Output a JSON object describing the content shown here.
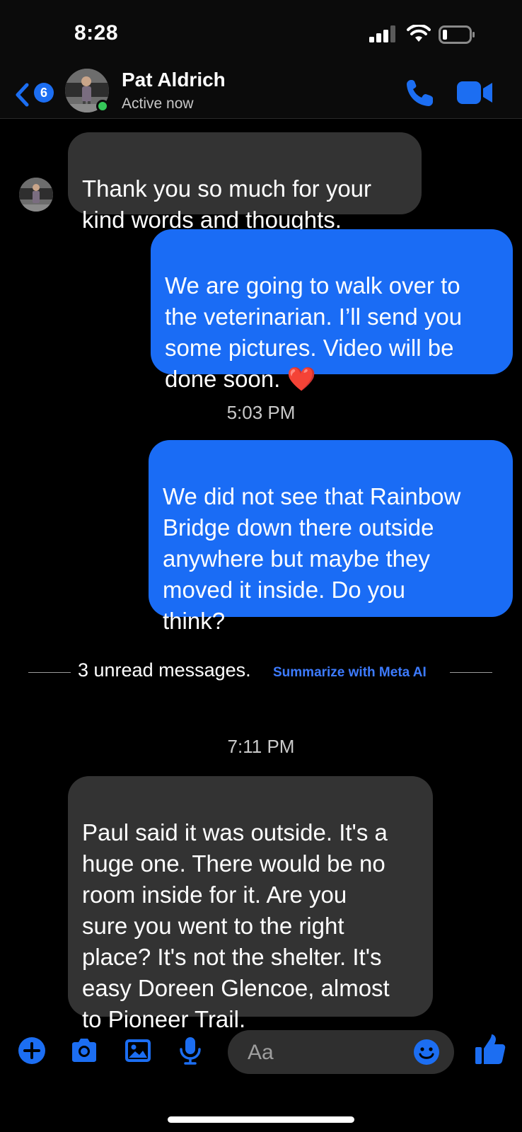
{
  "status_bar": {
    "time": "8:28"
  },
  "header": {
    "back_badge_count": "6",
    "contact_name": "Pat Aldrich",
    "contact_status": "Active now"
  },
  "messages": [
    {
      "direction": "incoming",
      "text": "Thank you so much for your\nkind words and thoughts."
    },
    {
      "direction": "outgoing",
      "text": "We are going to walk over to\nthe veterinarian. I’ll send you\nsome pictures. Video will be\ndone soon. ❤️"
    },
    {
      "direction": "outgoing",
      "text": "We did not see that Rainbow\nBridge down there outside\nanywhere but maybe they\nmoved it inside. Do you\nthink?"
    },
    {
      "direction": "incoming",
      "text": "Paul said it was outside. It's a\nhuge one. There would be no\nroom inside for it. Are you\nsure you went to the right\nplace? It's not the shelter. It's\neasy Doreen Glencoe, almost\nto Pioneer Trail."
    }
  ],
  "timestamps": [
    "5:03 PM",
    "7:11 PM"
  ],
  "unread_divider": {
    "text": "3 unread messages.",
    "action": "Summarize with Meta AI"
  },
  "composer": {
    "placeholder": "Aa",
    "icons": [
      "plus-icon",
      "camera-icon",
      "gallery-icon",
      "microphone-icon",
      "emoji-icon",
      "thumbs-up-icon"
    ]
  },
  "colors": {
    "accent": "#1a6cf5",
    "incoming_bubble": "#333333",
    "online": "#35c759",
    "link": "#3d7bff"
  }
}
